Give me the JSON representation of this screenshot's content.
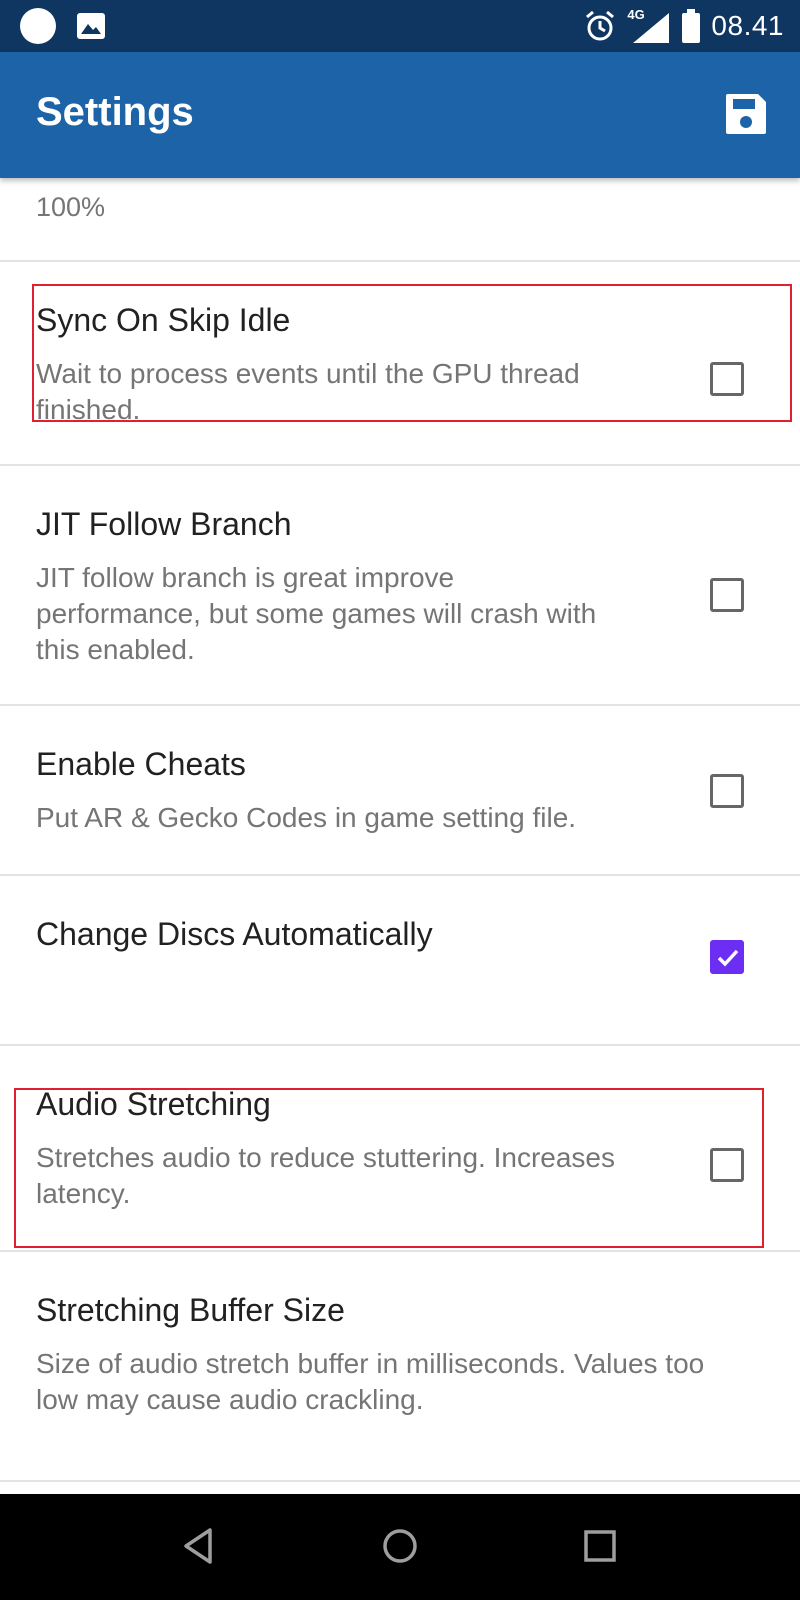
{
  "status_bar": {
    "time": "08.41",
    "network": "4G",
    "icons": [
      "notification-dot-icon",
      "image-icon",
      "alarm-icon",
      "signal-icon",
      "battery-icon"
    ]
  },
  "app_bar": {
    "title": "Settings",
    "action_icon": "save-icon"
  },
  "content": {
    "partial_value": "100%",
    "items": [
      {
        "title": "Sync On Skip Idle",
        "summary": "Wait to process events until the GPU thread finished.",
        "checked": false,
        "highlighted": true
      },
      {
        "title": "JIT Follow Branch",
        "summary": "JIT follow branch is great improve performance, but some games will crash with this enabled.",
        "checked": false,
        "highlighted": false
      },
      {
        "title": "Enable Cheats",
        "summary": "Put AR & Gecko Codes in game setting file.",
        "checked": false,
        "highlighted": false
      },
      {
        "title": "Change Discs Automatically",
        "summary": "",
        "checked": true,
        "highlighted": false
      },
      {
        "title": "Audio Stretching",
        "summary": "Stretches audio to reduce stuttering. Increases latency.",
        "checked": false,
        "highlighted": true
      },
      {
        "title": "Stretching Buffer Size",
        "summary": "Size of audio stretch buffer in milliseconds. Values too low may cause audio crackling.",
        "highlighted": false
      }
    ]
  },
  "nav_bar": {
    "icons": [
      "back-icon",
      "home-icon",
      "recents-icon"
    ]
  },
  "colors": {
    "status_bar": "#0f3561",
    "app_bar": "#1c63a8",
    "checkbox_checked": "#6b2ef2",
    "highlight_border": "#e0202e"
  }
}
